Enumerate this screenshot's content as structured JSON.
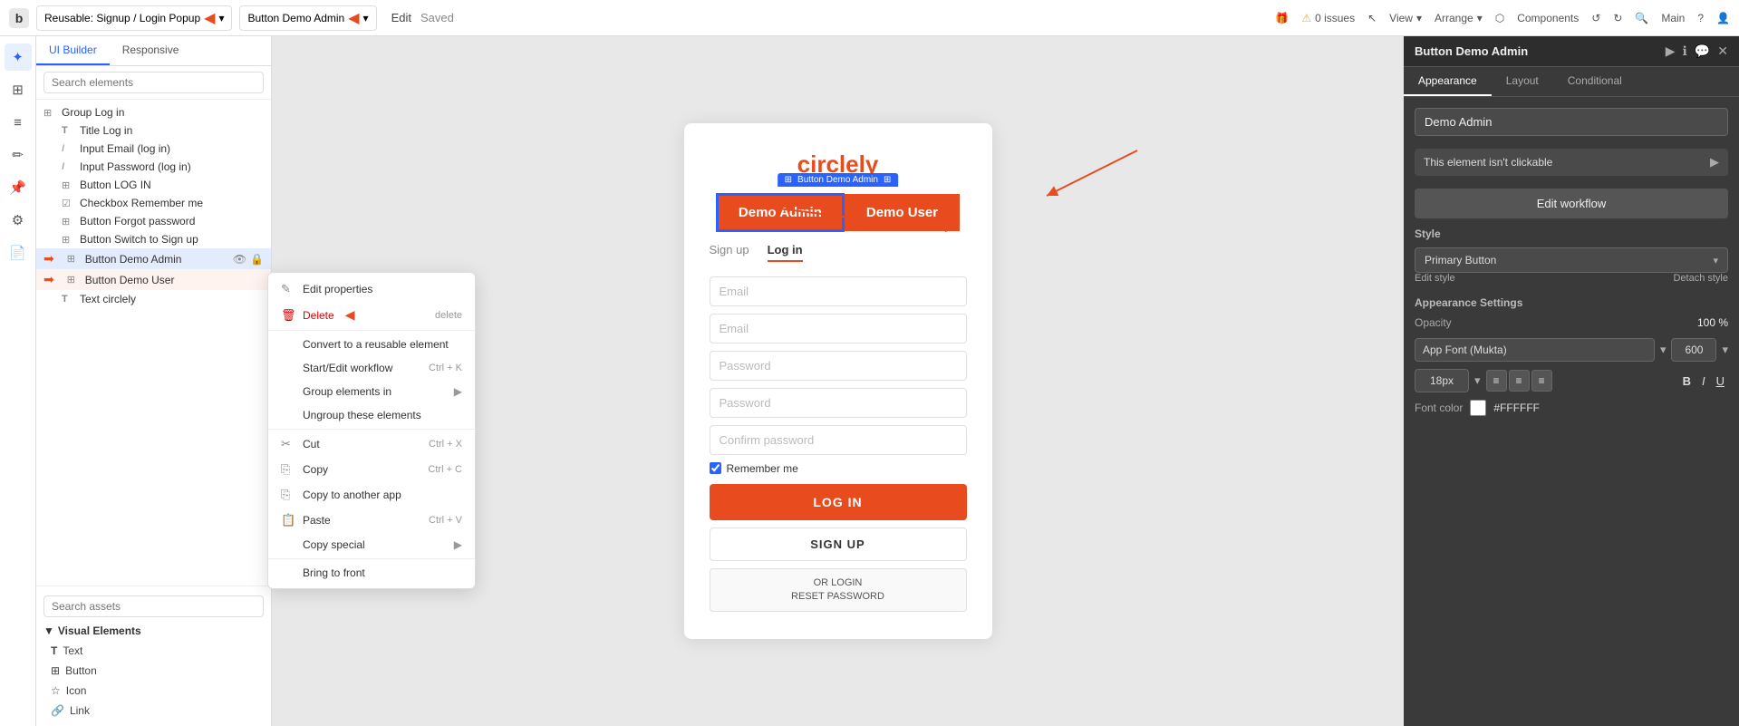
{
  "topbar": {
    "logo": "b",
    "reusable_label": "Reusable: Signup / Login Popup",
    "page_label": "Button Demo Admin",
    "edit_label": "Edit",
    "saved_label": "Saved",
    "issues_label": "0 issues",
    "view_label": "View",
    "arrange_label": "Arrange",
    "components_label": "Components",
    "main_label": "Main"
  },
  "tree": {
    "search_placeholder": "Search elements",
    "tab_builder": "UI Builder",
    "tab_responsive": "Responsive",
    "items": [
      {
        "id": "group-login",
        "label": "Group Log in",
        "icon": "⊞",
        "depth": 0,
        "type": "group"
      },
      {
        "id": "title-login",
        "label": "Title Log in",
        "icon": "T",
        "depth": 1,
        "type": "text"
      },
      {
        "id": "input-email",
        "label": "Input Email (log in)",
        "icon": "I",
        "depth": 1,
        "type": "input"
      },
      {
        "id": "input-password",
        "label": "Input Password (log in)",
        "icon": "I",
        "depth": 1,
        "type": "input"
      },
      {
        "id": "button-login",
        "label": "Button LOG IN",
        "icon": "⊞",
        "depth": 1,
        "type": "button"
      },
      {
        "id": "checkbox-remember",
        "label": "Checkbox Remember me",
        "icon": "☑",
        "depth": 1,
        "type": "checkbox"
      },
      {
        "id": "button-forgot",
        "label": "Button Forgot password",
        "icon": "⊞",
        "depth": 1,
        "type": "button"
      },
      {
        "id": "button-switch",
        "label": "Button Switch to Sign up",
        "icon": "⊞",
        "depth": 1,
        "type": "button"
      },
      {
        "id": "button-demo-admin",
        "label": "Button Demo Admin",
        "icon": "⊞",
        "depth": 1,
        "type": "button",
        "selected": true,
        "has_red_arrow": true
      },
      {
        "id": "button-demo-user",
        "label": "Button Demo User",
        "icon": "⊞",
        "depth": 1,
        "type": "button",
        "highlighted": true,
        "has_red_arrow": true
      },
      {
        "id": "text-circlely",
        "label": "Text circlely",
        "icon": "T",
        "depth": 1,
        "type": "text"
      }
    ]
  },
  "assets": {
    "search_placeholder": "Search assets",
    "group_label": "Visual Elements",
    "items": [
      {
        "id": "text",
        "label": "Text",
        "icon": "T"
      },
      {
        "id": "button",
        "label": "Button",
        "icon": "⊞"
      },
      {
        "id": "icon",
        "label": "Icon",
        "icon": "☆"
      },
      {
        "id": "link",
        "label": "Link",
        "icon": "🔗"
      }
    ]
  },
  "context_menu": {
    "items": [
      {
        "id": "edit-properties",
        "label": "Edit properties",
        "icon": "✎",
        "shortcut": ""
      },
      {
        "id": "delete",
        "label": "Delete",
        "icon": "🗑",
        "shortcut": "delete",
        "color": "red"
      },
      {
        "id": "convert-reusable",
        "label": "Convert to a reusable element",
        "icon": "",
        "shortcut": ""
      },
      {
        "id": "start-workflow",
        "label": "Start/Edit workflow",
        "icon": "",
        "shortcut": "Ctrl + K"
      },
      {
        "id": "group-elements",
        "label": "Group elements in",
        "icon": "",
        "shortcut": "▶"
      },
      {
        "id": "ungroup",
        "label": "Ungroup these elements",
        "icon": "",
        "shortcut": ""
      },
      {
        "id": "cut",
        "label": "Cut",
        "icon": "✂",
        "shortcut": "Ctrl + X"
      },
      {
        "id": "copy",
        "label": "Copy",
        "icon": "⎘",
        "shortcut": "Ctrl + C"
      },
      {
        "id": "copy-another-app",
        "label": "Copy to another app",
        "icon": "⎘",
        "shortcut": ""
      },
      {
        "id": "paste",
        "label": "Paste",
        "icon": "📋",
        "shortcut": "Ctrl + V"
      },
      {
        "id": "copy-special",
        "label": "Copy special",
        "icon": "",
        "shortcut": "▶"
      },
      {
        "id": "bring-to-front",
        "label": "Bring to front",
        "icon": "",
        "shortcut": ""
      }
    ]
  },
  "canvas": {
    "logo_text": "circlely",
    "tabs": [
      "Sign up",
      "Log in"
    ],
    "active_tab": "Log in",
    "fields": [
      "Email",
      "Email",
      "Password",
      "Password",
      "Confirm password"
    ],
    "checkbox_label": "Remember me",
    "login_btn": "LOG IN",
    "signup_btn": "SIGN UP",
    "reset_btn": "OR LOGIN\nRESET PASSWORD",
    "demo_admin_btn": "Demo Admin",
    "demo_user_btn": "Demo User",
    "selection_label": "Button Demo Admin"
  },
  "right_panel": {
    "title": "Button Demo Admin",
    "tabs": [
      "Appearance",
      "Layout",
      "Conditional"
    ],
    "active_tab": "Appearance",
    "element_name": "Demo Admin",
    "not_clickable_label": "This element isn't clickable",
    "edit_workflow_btn": "Edit workflow",
    "style_section": "Style",
    "style_value": "Primary Button",
    "edit_style_label": "Edit style",
    "detach_style_label": "Detach style",
    "appearance_settings": "Appearance Settings",
    "opacity_label": "Opacity",
    "opacity_value": "100 %",
    "font_label": "App Font (Mukta)",
    "font_weight": "600",
    "font_size": "18px",
    "align_options": [
      "≡",
      "≡",
      "≡"
    ],
    "bold_label": "B",
    "italic_label": "I",
    "underline_label": "U",
    "font_color_label": "Font color",
    "font_color_hex": "#FFFFFF",
    "font_color_swatch": "#FFFFFF"
  }
}
